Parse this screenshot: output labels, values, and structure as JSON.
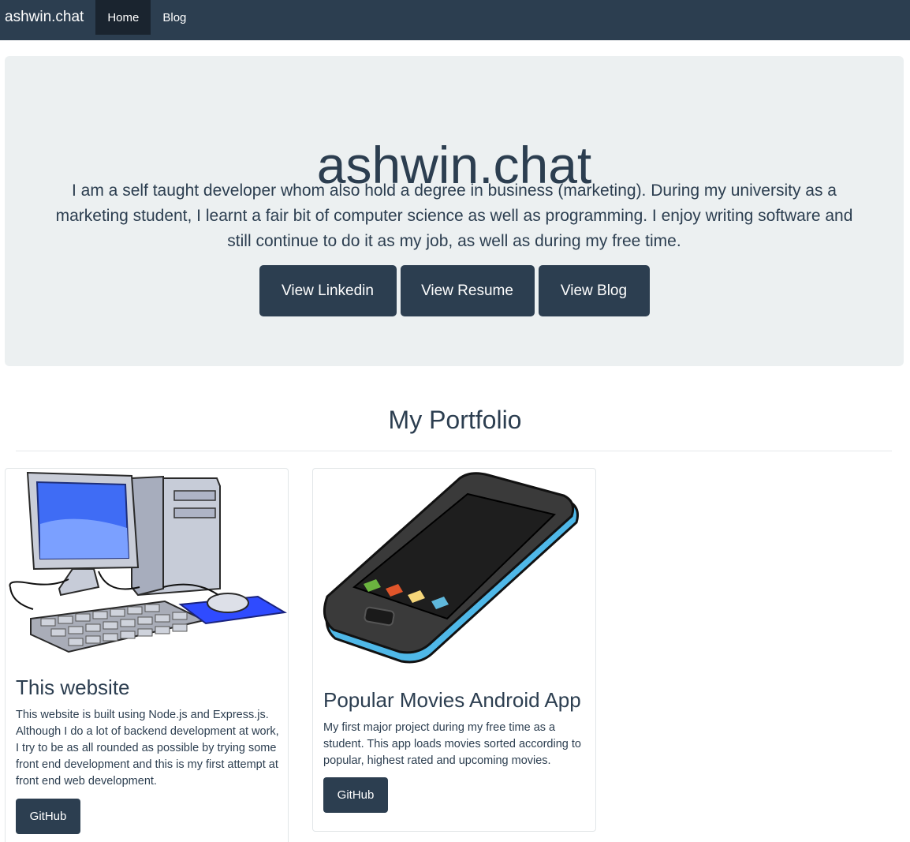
{
  "navbar": {
    "brand": "ashwin.chat",
    "links": [
      {
        "label": "Home",
        "active": true
      },
      {
        "label": "Blog",
        "active": false
      }
    ]
  },
  "hero": {
    "title": "ashwin.chat",
    "description": "I am a self taught developer whom also hold a degree in business (marketing). During my university as a marketing student, I learnt a fair bit of computer science as well as programming. I enjoy writing software and still continue to do it as my job, as well as during my free time.",
    "buttons": [
      "View Linkedin",
      "View Resume",
      "View Blog"
    ]
  },
  "portfolio": {
    "heading": "My Portfolio",
    "cards": [
      {
        "image": "desktop-computer-icon",
        "title": "This website",
        "description": "This website is built using Node.js and Express.js. Although I do a lot of backend development at work, I try to be as all rounded as possible by trying some front end development and this is my first attempt at front end web development.",
        "button": "GitHub"
      },
      {
        "image": "smartphone-icon",
        "title": "Popular Movies Android App",
        "description": "My first major project during my free time as a student. This app loads movies sorted according to popular, highest rated and upcoming movies.",
        "button": "GitHub"
      }
    ]
  },
  "colors": {
    "primary": "#2c3e50",
    "nav_active": "#1a242f",
    "jumbotron_bg": "#ecf0f1"
  }
}
